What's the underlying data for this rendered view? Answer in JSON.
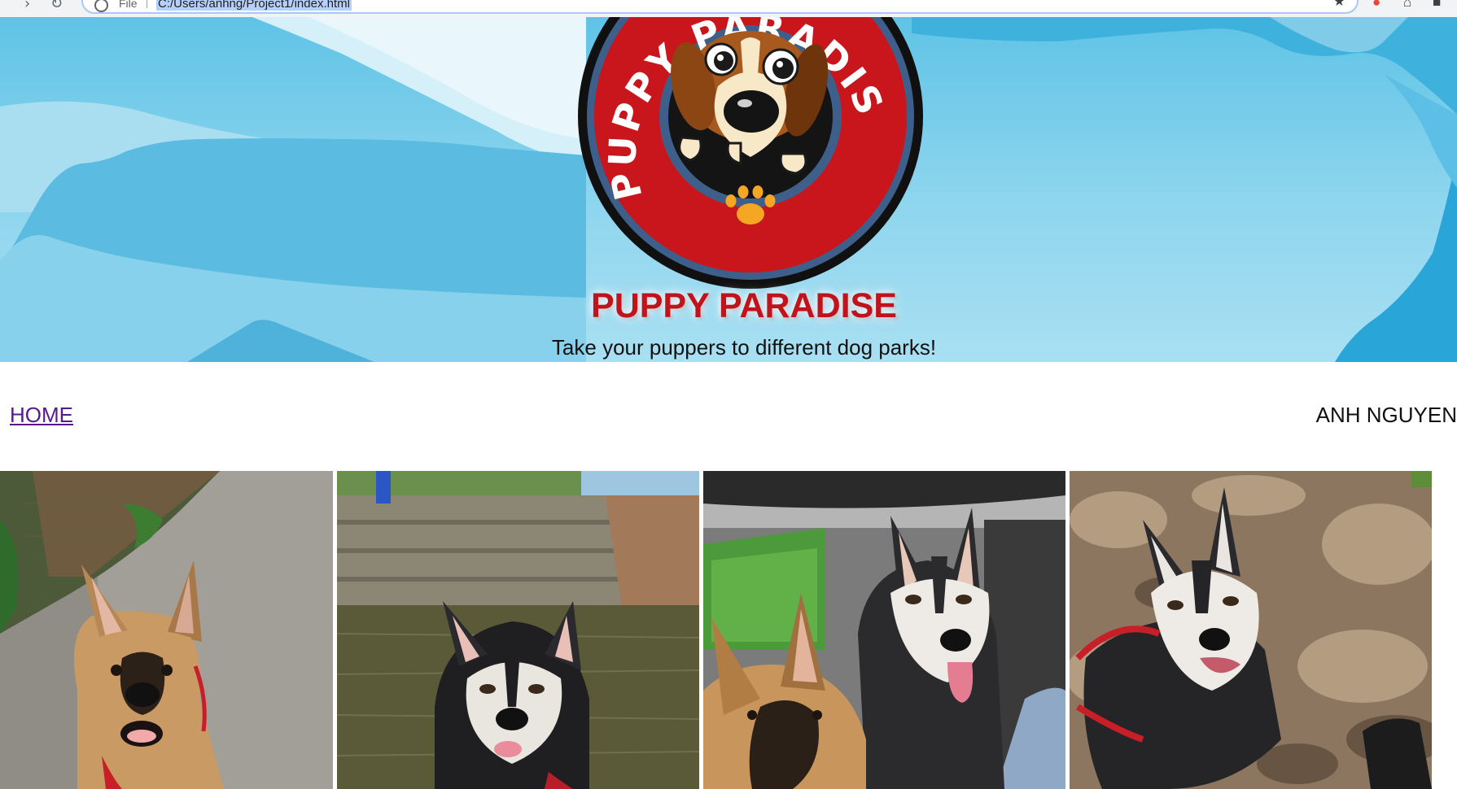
{
  "browser": {
    "scheme_label": "File",
    "url": "C:/Users/anhng/Project1/index.html"
  },
  "header": {
    "logo_text": "PUPPY PARADISE",
    "title": "PUPPY PARADISE",
    "tagline": "Take your puppers to different dog parks!"
  },
  "nav": {
    "home_label": "HOME",
    "author": "ANH NGUYEN"
  },
  "gallery": {
    "photos": [
      {
        "subject": "German shepherd sitting on a gravel path by a fence"
      },
      {
        "subject": "Husky standing in water"
      },
      {
        "subject": "German shepherd and husky in a car"
      },
      {
        "subject": "Husky in red harness on rocky ground"
      }
    ]
  },
  "colors": {
    "sky": "#5fc3e6",
    "title_red": "#c0141c",
    "logo_red": "#c8161c",
    "link_visited": "#551a8b"
  },
  "icons": {
    "browser_back": "arrow-right-icon",
    "browser_reload": "reload-icon",
    "bookmark": "star-icon",
    "logo_paw": "paw-icon"
  }
}
